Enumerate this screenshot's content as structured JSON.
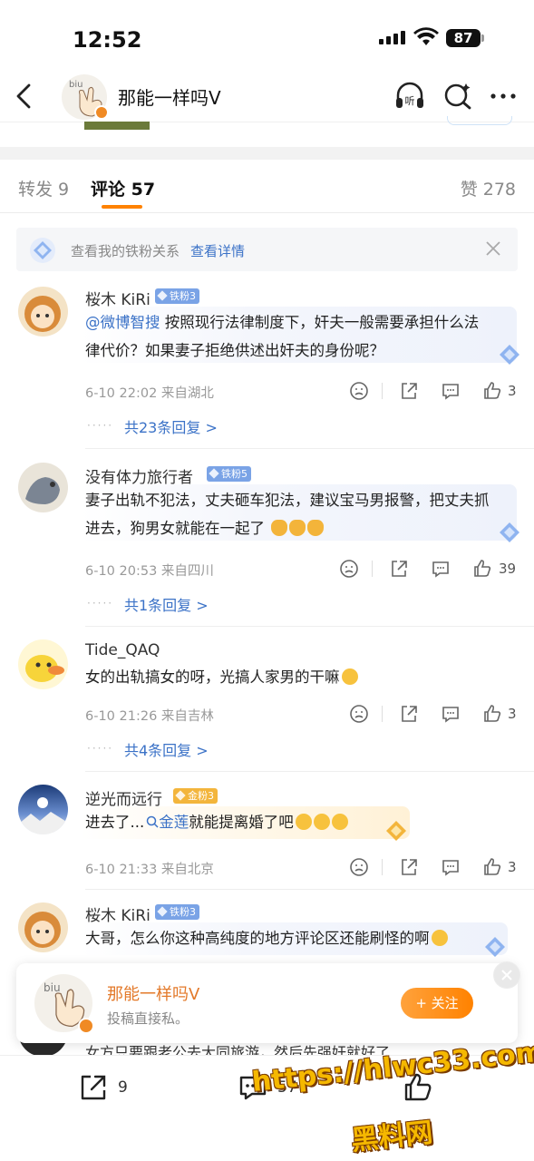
{
  "status_bar": {
    "time": "12:52",
    "battery": "87"
  },
  "nav": {
    "title": "那能一样吗V",
    "avatar_text": "biu",
    "listen_label": "听"
  },
  "tabs": {
    "repost": "转发 9",
    "comment": "评论 57",
    "like": "赞 278"
  },
  "banner": {
    "text": "查看我的铁粉关系",
    "link": "查看详情"
  },
  "comments": [
    {
      "name": "桜木 KiRi",
      "badge": "铁粉3",
      "badge_type": "iron",
      "mention": "@微博智搜",
      "line1": " 按照现行法律制度下，奸夫一般需要承担什么法",
      "line2": "律代价？如果妻子拒绝供述出奸夫的身份呢？",
      "meta": "6-10 22:02  来自湖北",
      "likes": "3",
      "replies": "共23条回复 >"
    },
    {
      "name": "没有体力旅行者",
      "badge": "铁粉5",
      "badge_type": "iron",
      "line1": "妻子出轨不犯法，丈夫砸车犯法，建议宝马男报警，把丈夫抓",
      "line2": "进去，狗男女就能在一起了",
      "meta": "6-10 20:53  来自四川",
      "likes": "39",
      "replies": "共1条回复 >"
    },
    {
      "name": "Tide_QAQ",
      "line1": "女的出轨搞女的呀，光搞人家男的干嘛",
      "meta": "6-10 21:26  来自吉林",
      "likes": "3",
      "replies": "共4条回复 >"
    },
    {
      "name": "逆光而远行",
      "badge": "金粉3",
      "badge_type": "gold",
      "pre": "进去了...",
      "topic": "金莲",
      "post": "就能提离婚了吧",
      "meta": "6-10 21:33  来自北京",
      "likes": "3"
    },
    {
      "name": "桜木 KiRi",
      "badge": "铁粉3",
      "badge_type": "iron",
      "line1": "大哥，怎么你这种高纯度的地方评论区还能刷怪的啊"
    }
  ],
  "follow_card": {
    "name": "那能一样吗V",
    "sub": "投稿直接私。",
    "button": "+ 关注"
  },
  "under_text": "女方只要跟老公去大同旅游，然后先强奸就好了",
  "bottom_bar": {
    "repost_count": "9",
    "comment_count": "57"
  },
  "watermark": {
    "line1": "https://hlwc33.com",
    "line2": "黑料网"
  },
  "colors": {
    "accent": "#ff8200",
    "link": "#3b72c7",
    "iron_badge": "#7aa3e6",
    "gold_badge": "#f3b53c"
  }
}
